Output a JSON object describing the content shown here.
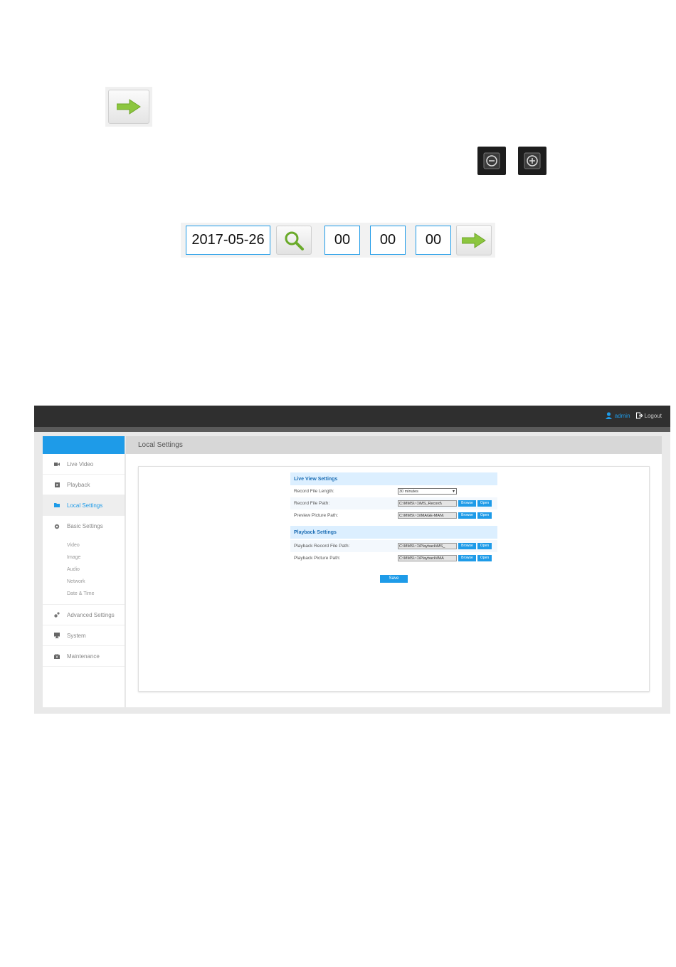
{
  "colors": {
    "accent": "#1e9be8",
    "arrow_green": "#8cc63f",
    "topbar": "#2f2f2f"
  },
  "icons": {
    "go_arrow": "arrow-right-icon",
    "zoom_out": "zoom-out-icon",
    "zoom_in": "zoom-in-icon",
    "search": "magnifier-icon"
  },
  "search_bar": {
    "date": "2017-05-26",
    "hour": "00",
    "minute": "00",
    "second": "00"
  },
  "web_ui": {
    "user": "admin",
    "logout_label": "Logout",
    "page_title": "Local Settings",
    "sidebar": {
      "items": [
        {
          "label": "Live Video",
          "icon": "camera-icon"
        },
        {
          "label": "Playback",
          "icon": "playback-icon"
        },
        {
          "label": "Local Settings",
          "icon": "folder-icon",
          "active": true
        },
        {
          "label": "Basic Settings",
          "icon": "gear-icon"
        },
        {
          "label": "Advanced Settings",
          "icon": "gears-icon"
        },
        {
          "label": "System",
          "icon": "monitor-icon"
        },
        {
          "label": "Maintenance",
          "icon": "toolbox-icon"
        }
      ],
      "basic_sub": [
        "Video",
        "Image",
        "Audio",
        "Network",
        "Date & Time"
      ]
    },
    "live_view": {
      "title": "Live View Settings",
      "record_length_label": "Record File Length:",
      "record_length_value": "30 minutes",
      "record_path_label": "Record File Path:",
      "record_path_value": "C:\\MMS\\~1\\MS_Record\\",
      "preview_path_label": "Preview Picture Path:",
      "preview_path_value": "C:\\MMS\\~1\\IMAGE-MAN\\"
    },
    "playback": {
      "title": "Playback Settings",
      "record_path_label": "Playback Record File Path:",
      "record_path_value": "C:\\MMS\\~1\\Playback\\MS_",
      "picture_path_label": "Playback Picture Path:",
      "picture_path_value": "C:\\MMS\\~1\\Playback\\IMA"
    },
    "buttons": {
      "browse": "Browse",
      "open": "Open",
      "save": "Save"
    }
  }
}
